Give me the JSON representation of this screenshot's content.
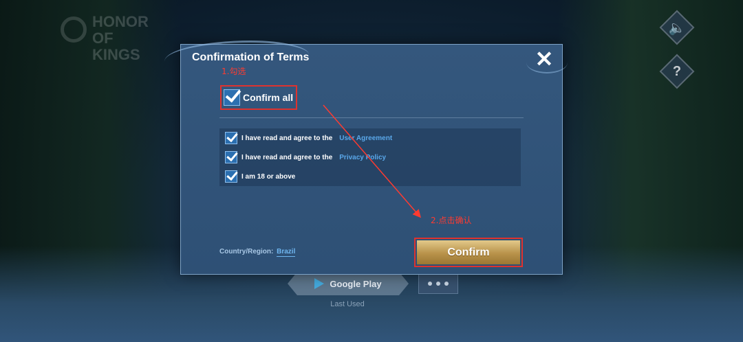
{
  "background": {
    "logo_text": "HONOR OF KINGS",
    "sound_icon": "speaker-icon",
    "help_icon": "question-icon",
    "google_play_label": "Google Play",
    "last_used_label": "Last Used"
  },
  "dialog": {
    "title": "Confirmation of Terms",
    "close_icon": "close-icon",
    "confirm_all_label": "Confirm all",
    "confirm_all_checked": true,
    "terms": [
      {
        "text": "I have read and agree to the",
        "link": "User Agreement",
        "checked": true
      },
      {
        "text": "I have read and agree to the",
        "link": "Privacy Policy",
        "checked": true
      },
      {
        "text": "I am 18 or above",
        "link": "",
        "checked": true
      }
    ],
    "country_label": "Country/Region:",
    "country_value": "Brazil",
    "confirm_button_label": "Confirm"
  },
  "annotations": {
    "step1": "1.勾选",
    "step2": "2.点击确认",
    "color": "#ff3b30"
  },
  "colors": {
    "dialog_bg": "#34577d",
    "link": "#5aa8ea",
    "confirm_gold": "#c9a860",
    "highlight_red": "#e0322e"
  }
}
